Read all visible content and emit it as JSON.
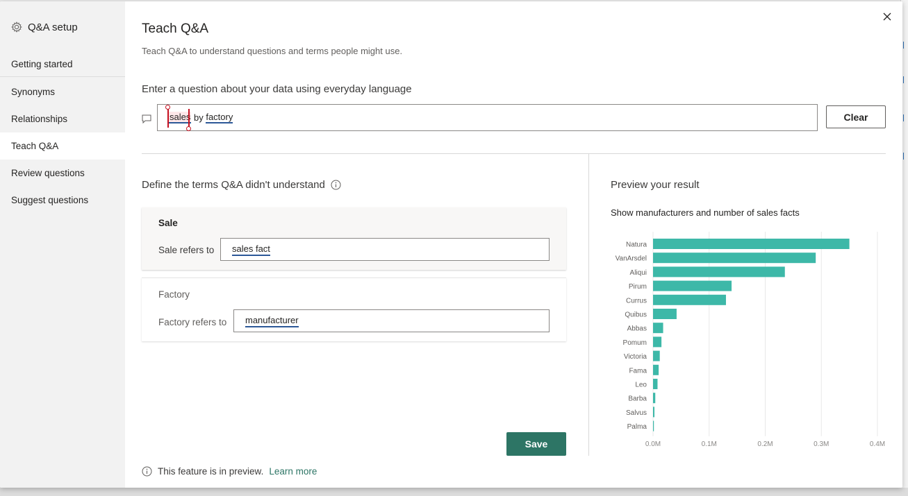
{
  "sidebar": {
    "header": "Q&A setup",
    "items": [
      {
        "label": "Getting started"
      },
      {
        "label": "Synonyms"
      },
      {
        "label": "Relationships"
      },
      {
        "label": "Teach Q&A"
      },
      {
        "label": "Review questions"
      },
      {
        "label": "Suggest questions"
      }
    ]
  },
  "main": {
    "title": "Teach Q&A",
    "subtitle": "Teach Q&A to understand questions and terms people might use.",
    "question_label": "Enter a question about your data using everyday language",
    "question": {
      "word1": "sales",
      "word2": "by",
      "word3": "factory"
    },
    "clear_label": "Clear",
    "define_label": "Define the terms Q&A didn't understand",
    "terms": [
      {
        "name": "Sale",
        "refers_label": "Sale refers to",
        "value": "sales fact"
      },
      {
        "name": "Factory",
        "refers_label": "Factory refers to",
        "value": "manufacturer"
      }
    ],
    "save_label": "Save",
    "footer_text": "This feature is in preview.",
    "footer_link": "Learn more"
  },
  "preview": {
    "label": "Preview your result",
    "chart_title": "Show manufacturers and number of sales facts"
  },
  "colors": {
    "bar": "#3db8a8",
    "accent": "#2d7565",
    "error": "#c50f1f"
  },
  "chart_data": {
    "type": "bar",
    "orientation": "horizontal",
    "title": "Show manufacturers and number of sales facts",
    "categories": [
      "Natura",
      "VanArsdel",
      "Aliqui",
      "Pirum",
      "Currus",
      "Quibus",
      "Abbas",
      "Pomum",
      "Victoria",
      "Fama",
      "Leo",
      "Barba",
      "Salvus",
      "Palma"
    ],
    "values": [
      350000,
      290000,
      235000,
      140000,
      130000,
      42000,
      18000,
      15000,
      12000,
      10000,
      8000,
      4000,
      2500,
      1500
    ],
    "xticks": [
      0,
      100000,
      200000,
      300000,
      400000
    ],
    "xtick_labels": [
      "0.0M",
      "0.1M",
      "0.2M",
      "0.3M",
      "0.4M"
    ],
    "xlim": [
      0,
      400000
    ],
    "grid": true
  }
}
